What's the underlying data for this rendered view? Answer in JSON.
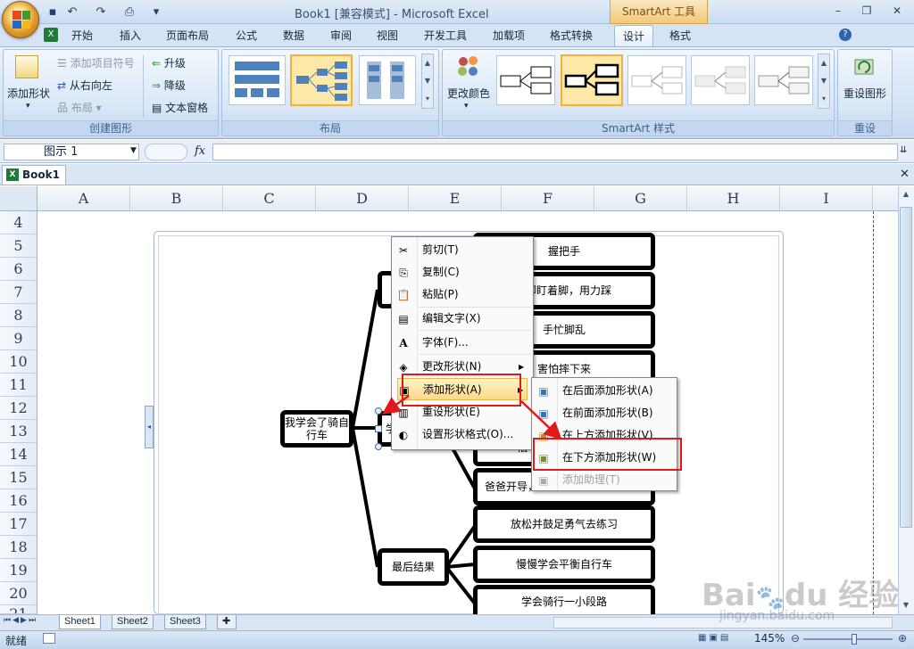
{
  "window": {
    "title": "Book1  [兼容模式] - Microsoft Excel",
    "context_tool": "SmartArt 工具",
    "minimize": "–",
    "restore": "❐",
    "close": "✕"
  },
  "qat": {
    "save_icon": "▪",
    "undo_icon": "↶",
    "redo_icon": "↷",
    "print_icon": "⎙",
    "more_icon": "▾"
  },
  "tabs": [
    "开始",
    "插入",
    "页面布局",
    "公式",
    "数据",
    "审阅",
    "视图",
    "开发工具",
    "加载项",
    "格式转换",
    "设计",
    "格式"
  ],
  "active_tab": "设计",
  "ribbon": {
    "create_group": {
      "label": "创建图形",
      "add_shape": "添加形状",
      "add_bullet": "添加项目符号",
      "right_to_left": "从右向左",
      "layout": "布局",
      "promote": "升级",
      "demote": "降级",
      "text_pane": "文本窗格"
    },
    "layout_group": {
      "label": "布局"
    },
    "styles_group": {
      "label": "SmartArt 样式",
      "change_colors": "更改颜色"
    },
    "reset_group": {
      "label": "重设",
      "reset_graphic": "重设图形"
    }
  },
  "formula_bar": {
    "name_box": "图示 1",
    "fx": "fx"
  },
  "workbook_tab": "Book1",
  "columns": [
    "A",
    "B",
    "C",
    "D",
    "E",
    "F",
    "G",
    "H",
    "I"
  ],
  "rows": [
    "4",
    "5",
    "6",
    "7",
    "8",
    "9",
    "10",
    "11",
    "12",
    "13",
    "14",
    "15",
    "16",
    "17",
    "18",
    "19",
    "20",
    "21"
  ],
  "smartart": {
    "root": "我学会了骑自行车",
    "mid_top": "",
    "mid_selected": "学",
    "mid_bottom": "最后结果",
    "leaves": [
      "握把手",
      "脚盯着脚，用力踩",
      "手忙脚乱",
      "害怕摔下来",
      "怕",
      "爸爸开导，教我要点，让我放松",
      "放松并鼓足勇气去练习",
      "慢慢学会平衡自行车",
      "学会骑行一小段路"
    ],
    "leaf6_visible": "爸爸开导，"
  },
  "context_menu": [
    {
      "icon": "✂",
      "label": "剪切(T)",
      "disabled": false
    },
    {
      "icon": "⎘",
      "label": "复制(C)",
      "disabled": false
    },
    {
      "icon": "📋",
      "label": "粘贴(P)",
      "disabled": false
    },
    {
      "icon": "▤",
      "label": "编辑文字(X)",
      "disabled": false
    },
    {
      "icon": "A",
      "label": "字体(F)...",
      "disabled": false
    },
    {
      "icon": "◈",
      "label": "更改形状(N)",
      "disabled": false,
      "submenu": true
    },
    {
      "icon": "▣",
      "label": "添加形状(A)",
      "disabled": false,
      "submenu": true,
      "highlighted": true
    },
    {
      "icon": "▥",
      "label": "重设形状(E)",
      "disabled": false
    },
    {
      "icon": "◐",
      "label": "设置形状格式(O)...",
      "disabled": false
    }
  ],
  "submenu": [
    {
      "label": "在后面添加形状(A)",
      "disabled": false
    },
    {
      "label": "在前面添加形状(B)",
      "disabled": false
    },
    {
      "label": "在上方添加形状(V)",
      "disabled": false
    },
    {
      "label": "在下方添加形状(W)",
      "disabled": false,
      "boxed": true
    },
    {
      "label": "添加助理(T)",
      "disabled": true
    }
  ],
  "sheets": [
    "Sheet1",
    "Sheet2",
    "Sheet3"
  ],
  "status": {
    "ready": "就绪",
    "zoom": "145%"
  },
  "watermark": {
    "brand": "Bai du 经验",
    "url": "jingyan.baidu.com"
  },
  "colors": {
    "accent_red": "#e01a1a",
    "highlight": "#fbd98a",
    "ribbon": "#d2e2f5"
  }
}
